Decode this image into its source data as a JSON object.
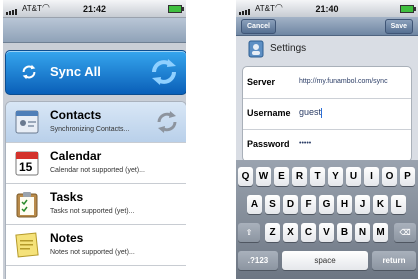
{
  "left_phone": {
    "status": {
      "carrier": "AT&T",
      "time": "21:42"
    },
    "sync_all": {
      "label": "Sync All"
    },
    "sources": [
      {
        "name": "Contacts",
        "status": "Synchronizing Contacts...",
        "icon": "contacts-icon"
      },
      {
        "name": "Calendar",
        "status": "Calendar not supported (yet)...",
        "icon": "calendar-icon",
        "day": "15"
      },
      {
        "name": "Tasks",
        "status": "Tasks not supported (yet)...",
        "icon": "tasks-icon"
      },
      {
        "name": "Notes",
        "status": "Notes not supported (yet)...",
        "icon": "notes-icon"
      }
    ]
  },
  "right_phone": {
    "status": {
      "carrier": "AT&T",
      "time": "21:40"
    },
    "nav": {
      "cancel_label": "Cancel",
      "save_label": "Save"
    },
    "settings_title": "Settings",
    "fields": {
      "server": {
        "label": "Server",
        "value": "http://my.funambol.com/sync"
      },
      "username": {
        "label": "Username",
        "value": "guest"
      },
      "password": {
        "label": "Password",
        "value": "•••••"
      }
    },
    "keyboard": {
      "row1": [
        "Q",
        "W",
        "E",
        "R",
        "T",
        "Y",
        "U",
        "I",
        "O",
        "P"
      ],
      "row2": [
        "A",
        "S",
        "D",
        "F",
        "G",
        "H",
        "J",
        "K",
        "L"
      ],
      "row3": [
        "Z",
        "X",
        "C",
        "V",
        "B",
        "N",
        "M"
      ],
      "numbers_key": ".?123",
      "space_key": "space",
      "return_key": "return"
    }
  },
  "colors": {
    "sync_blue": "#1f7fd6",
    "nav_blue": "#6f86a3",
    "battery_green": "#3fbf3f"
  }
}
